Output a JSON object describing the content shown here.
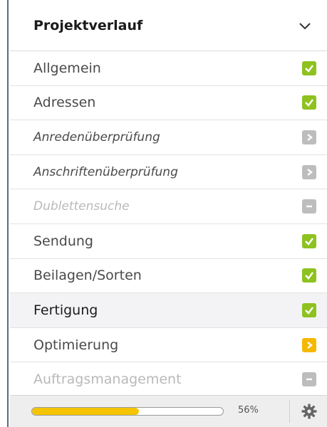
{
  "panel": {
    "title": "Projektverlauf",
    "collapse_icon": "chevron-down-icon"
  },
  "colors": {
    "done": "#8ec21f",
    "pending": "#bdbdbd",
    "current": "#f5b800",
    "progress_fill": "#f5c400"
  },
  "steps": [
    {
      "label": "Allgemein",
      "status": "done",
      "icon": "check-icon"
    },
    {
      "label": "Adressen",
      "status": "done",
      "icon": "check-icon"
    },
    {
      "label": "Anredenüberprüfung",
      "status": "skipped",
      "icon": "chevron-right-icon"
    },
    {
      "label": "Anschriftenüberprüfung",
      "status": "skipped",
      "icon": "chevron-right-icon"
    },
    {
      "label": "Dublettensuche",
      "status": "disabled",
      "icon": "minus-icon"
    },
    {
      "label": "Sendung",
      "status": "done",
      "icon": "check-icon"
    },
    {
      "label": "Beilagen/Sorten",
      "status": "done",
      "icon": "check-icon"
    },
    {
      "label": "Fertigung",
      "status": "done",
      "icon": "check-icon"
    },
    {
      "label": "Optimierung",
      "status": "current",
      "icon": "chevron-right-icon"
    },
    {
      "label": "Auftragsmanagement",
      "status": "disabled",
      "icon": "minus-icon"
    }
  ],
  "footer": {
    "progress_percent": 56,
    "progress_label": "56%",
    "settings_icon": "gear-icon"
  }
}
